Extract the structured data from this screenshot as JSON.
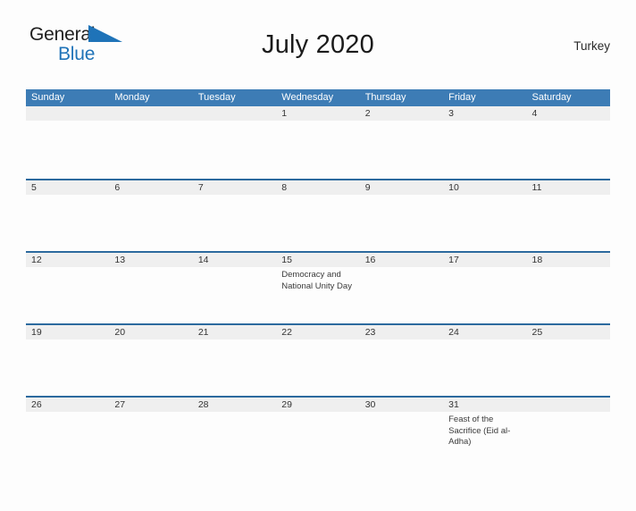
{
  "logo": {
    "line1": "General",
    "line2": "Blue",
    "flag_icon": "blue-triangle-flag-icon",
    "color_dark": "#202020",
    "color_blue": "#1f73b8"
  },
  "header": {
    "title": "July 2020",
    "region": "Turkey"
  },
  "colors": {
    "header_blue": "#3d7cb5",
    "row_divider_blue": "#2c6a9e",
    "day_band_gray": "#efefef",
    "page_background": "#fdfdfd"
  },
  "calendar": {
    "weekdays": [
      "Sunday",
      "Monday",
      "Tuesday",
      "Wednesday",
      "Thursday",
      "Friday",
      "Saturday"
    ],
    "weeks": [
      [
        {
          "day": "",
          "event": ""
        },
        {
          "day": "",
          "event": ""
        },
        {
          "day": "",
          "event": ""
        },
        {
          "day": "1",
          "event": ""
        },
        {
          "day": "2",
          "event": ""
        },
        {
          "day": "3",
          "event": ""
        },
        {
          "day": "4",
          "event": ""
        }
      ],
      [
        {
          "day": "5",
          "event": ""
        },
        {
          "day": "6",
          "event": ""
        },
        {
          "day": "7",
          "event": ""
        },
        {
          "day": "8",
          "event": ""
        },
        {
          "day": "9",
          "event": ""
        },
        {
          "day": "10",
          "event": ""
        },
        {
          "day": "11",
          "event": ""
        }
      ],
      [
        {
          "day": "12",
          "event": ""
        },
        {
          "day": "13",
          "event": ""
        },
        {
          "day": "14",
          "event": ""
        },
        {
          "day": "15",
          "event": "Democracy and National Unity Day"
        },
        {
          "day": "16",
          "event": ""
        },
        {
          "day": "17",
          "event": ""
        },
        {
          "day": "18",
          "event": ""
        }
      ],
      [
        {
          "day": "19",
          "event": ""
        },
        {
          "day": "20",
          "event": ""
        },
        {
          "day": "21",
          "event": ""
        },
        {
          "day": "22",
          "event": ""
        },
        {
          "day": "23",
          "event": ""
        },
        {
          "day": "24",
          "event": ""
        },
        {
          "day": "25",
          "event": ""
        }
      ],
      [
        {
          "day": "26",
          "event": ""
        },
        {
          "day": "27",
          "event": ""
        },
        {
          "day": "28",
          "event": ""
        },
        {
          "day": "29",
          "event": ""
        },
        {
          "day": "30",
          "event": ""
        },
        {
          "day": "31",
          "event": "Feast of the Sacrifice (Eid al-Adha)"
        },
        {
          "day": "",
          "event": ""
        }
      ]
    ]
  }
}
